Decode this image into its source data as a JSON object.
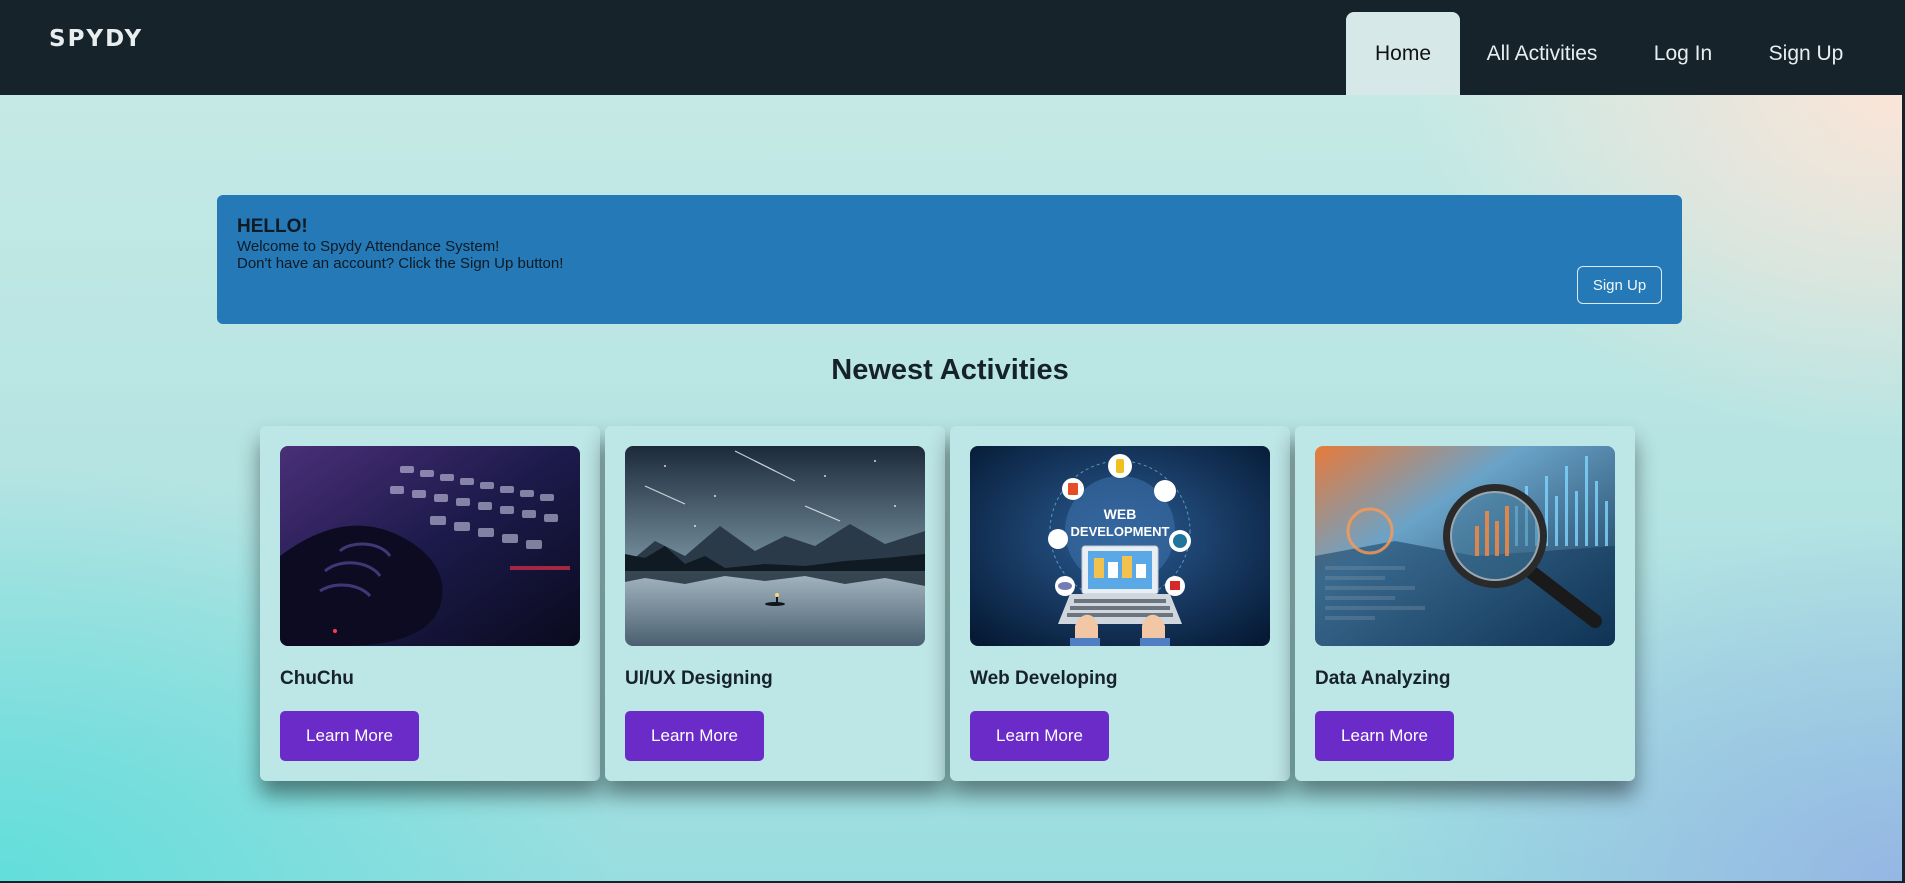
{
  "brand": "SPYDY",
  "nav": {
    "home": "Home",
    "all_activities": "All Activities",
    "login": "Log In",
    "signup": "Sign Up"
  },
  "hero": {
    "heading": "HELLO!",
    "line1": "Welcome to Spydy Attendance System!",
    "line2": "Don't have an account? Click the Sign Up button!",
    "button": "Sign Up"
  },
  "section_title": "Newest Activities",
  "activities": [
    {
      "title": "ChuChu",
      "button": "Learn More",
      "image": "keyboard-hand-image"
    },
    {
      "title": "UI/UX Designing",
      "button": "Learn More",
      "image": "mountain-lake-night-image"
    },
    {
      "title": "Web Developing",
      "button": "Learn More",
      "image": "web-development-laptop-image",
      "image_text": [
        "WEB",
        "DEVELOPMENT"
      ]
    },
    {
      "title": "Data Analyzing",
      "button": "Learn More",
      "image": "magnifier-data-chart-image"
    }
  ],
  "colors": {
    "navbar": "#17232b",
    "hero": "#2579b6",
    "button": "#6b2bc9",
    "card": "#bde6e7"
  }
}
